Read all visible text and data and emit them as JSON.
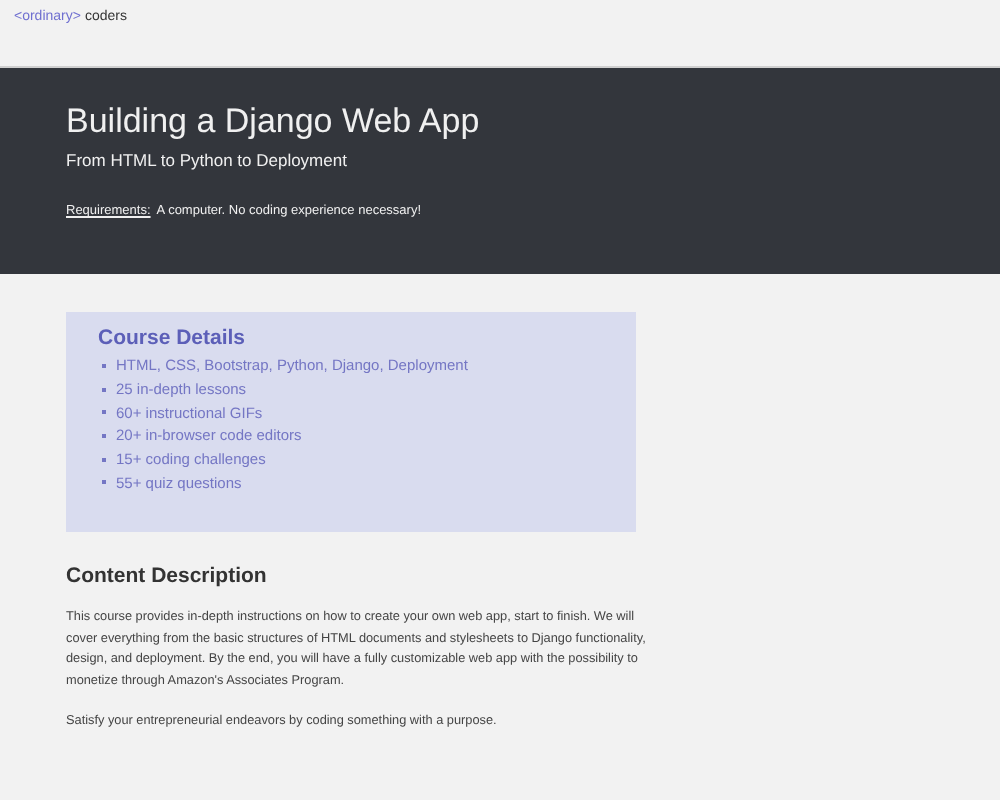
{
  "nav": {
    "brand_tag": "<ordinary>",
    "brand_name": "coders"
  },
  "hero": {
    "title": "Building a Django Web App",
    "subtitle": "From HTML to Python to Deployment",
    "requirements_label": "Requirements:",
    "requirements_text": "A computer. No coding experience necessary!"
  },
  "course_details": {
    "title": "Course Details",
    "items": [
      "HTML, CSS, Bootstrap, Python, Django, Deployment",
      "25 in-depth lessons",
      "60+ instructional GIFs",
      "20+ in-browser code editors",
      "15+ coding challenges",
      "55+ quiz questions"
    ]
  },
  "content_description": {
    "title": "Content Description",
    "paragraphs": [
      "This course provides in-depth instructions on how to create your own web app, start to finish. We will cover everything from the basic structures of HTML documents and stylesheets to Django functionality, design, and deployment. By the end, you will have a fully customizable web app with the possibility to monetize through Amazon's Associates Program.",
      "Satisfy your entrepreneurial endeavors by coding something with a purpose."
    ]
  }
}
